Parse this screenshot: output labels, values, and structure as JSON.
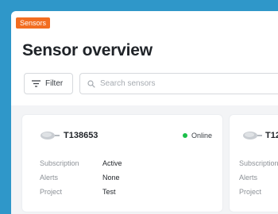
{
  "breadcrumb": {
    "label": "Sensors",
    "color": "#f26d21"
  },
  "page": {
    "title": "Sensor overview"
  },
  "toolbar": {
    "filter_label": "Filter",
    "filter_icon": "filter-lines-icon",
    "search_placeholder": "Search sensors",
    "search_icon": "search-icon"
  },
  "field_labels": {
    "subscription": "Subscription",
    "alerts": "Alerts",
    "project": "Project"
  },
  "sensors": [
    {
      "id": "T138653",
      "status": "Online",
      "status_color": "#1bbf4a",
      "subscription": "Active",
      "alerts": "None",
      "project": "Test"
    },
    {
      "id": "T12",
      "status": "",
      "subscription": "",
      "alerts": "",
      "project": ""
    }
  ],
  "colors": {
    "background": "#2f97c9",
    "accent": "#f26d21",
    "online": "#1bbf4a"
  }
}
